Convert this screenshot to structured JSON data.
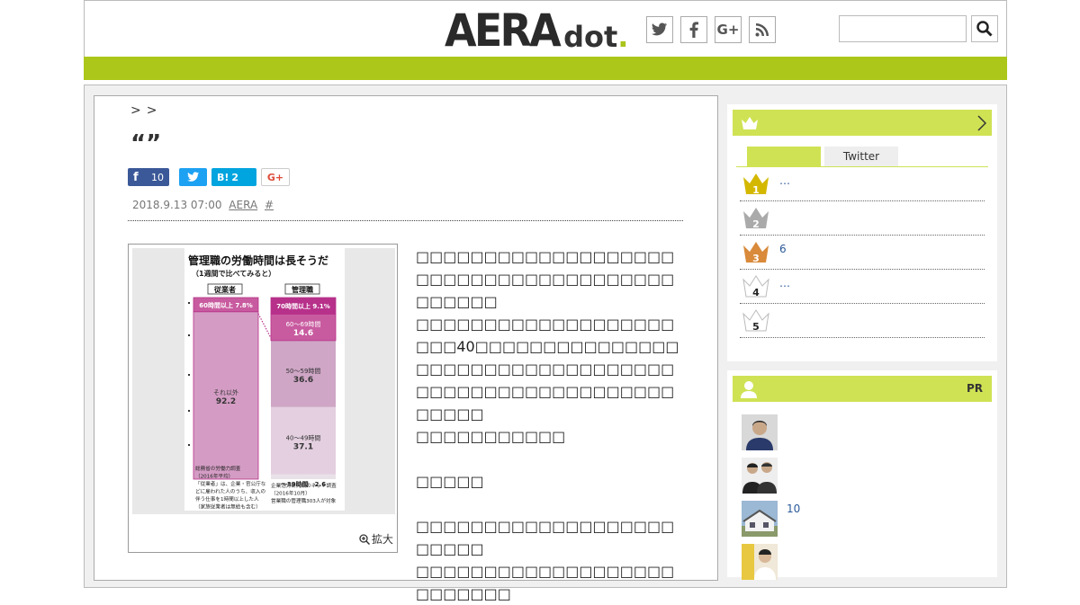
{
  "header": {
    "logo_main": "AERA",
    "logo_sub": "dot",
    "logo_dot": ".",
    "search": {
      "placeholder": "",
      "value": ""
    },
    "social_icons": [
      "twitter-icon",
      "facebook-icon",
      "google-plus-icon",
      "rss-icon"
    ]
  },
  "colors": {
    "brand_green": "#acc71a",
    "light_green": "#cfe254",
    "twitter": "#1da1f2",
    "hatena": "#00a4de",
    "facebook": "#3b5998"
  },
  "article": {
    "breadcrumb_sep1": ">",
    "breadcrumb_sep2": ">",
    "title": "“”",
    "share": {
      "facebook_count": "10",
      "hatena_label": "B!",
      "hatena_count": "2",
      "gplus_label": "G+"
    },
    "meta": {
      "date": "2018.9.13 07:00",
      "source": "AERA",
      "hash": "#"
    },
    "figure": {
      "zoom_label": "拡大"
    },
    "paragraphs": [
      "□□□□□□□□□□□□□□□□□□□□□□□□□□□□□□□□□□□□□□□□□□□□",
      "□□□□□□□□□□□□□□□□□□□□□□40□□□□□□□□□□□□□□□□□□□□□□□□□□□□□□□□□□□□□□□□□□□□□□□□□□□□□□□□□□",
      "□□□□□□□□□□□",
      "□□□□□",
      "□□□□□□□□□□□□□□□□□□□□□□□□",
      "□□□□□□□□□□□□□□□□□□□□□□□□□□"
    ]
  },
  "chart_data": {
    "type": "bar",
    "title": "管理職の労働時間は長そうだ",
    "subtitle": "（1週間で比べてみると）",
    "categories": [
      "従業者",
      "管理職"
    ],
    "series": [
      {
        "name": "",
        "values": [
          0,
          2.6
        ],
        "label": "〜39時間"
      },
      {
        "name": "",
        "values": [
          0,
          37.1
        ],
        "label": "40〜49時間"
      },
      {
        "name": "",
        "values": [
          0,
          36.6
        ],
        "label": "50〜59時間"
      },
      {
        "name": "",
        "values": [
          0,
          14.6
        ],
        "label": "60〜69時間"
      },
      {
        "name": "",
        "values": [
          0,
          9.1
        ],
        "label": "70時間以上"
      },
      {
        "name": "",
        "values": [
          92.2,
          0
        ],
        "label": "それ以外"
      },
      {
        "name": "",
        "values": [
          7.8,
          0
        ],
        "label": "60時間以上"
      }
    ],
    "notes": {
      "left": [
        "総務省の労働力調査",
        "（2016年平均）",
        "「従業者」は、企業・官公庁な",
        "どに雇われた人のうち、収入の",
        "伴う仕事を1時間以上した人",
        "（家族従業者は無給も含む）"
      ],
      "right": [
        "企業活力研究所のネット調査",
        "（2016年10月）",
        "営業職の管理職303人が対象"
      ]
    }
  },
  "sidebar": {
    "ranking": {
      "tabs": [
        "",
        "Twitter"
      ],
      "items": [
        {
          "num": "1",
          "text": "…",
          "color": "#d4b800"
        },
        {
          "num": "2",
          "text": "",
          "color": "#aaaaaa"
        },
        {
          "num": "3",
          "text": "6",
          "color": "#d98a3a"
        },
        {
          "num": "4",
          "text": "…",
          "color": "#dddddd"
        },
        {
          "num": "5",
          "text": "",
          "color": "#dddddd"
        }
      ]
    },
    "pr": {
      "label": "PR",
      "items": [
        {
          "text": ""
        },
        {
          "text": ""
        },
        {
          "text": "10"
        },
        {
          "text": ""
        }
      ]
    }
  }
}
